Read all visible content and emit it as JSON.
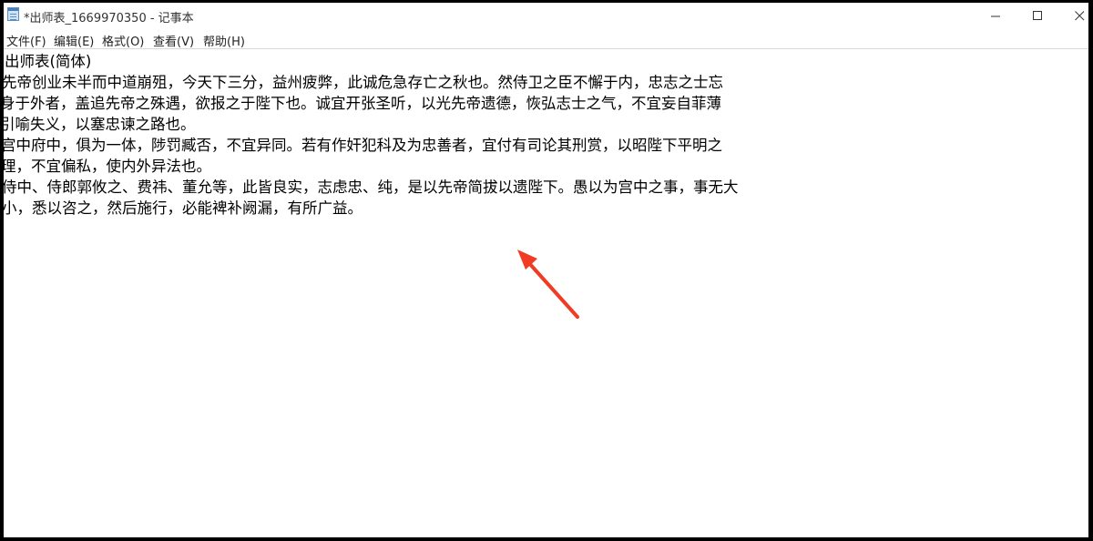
{
  "window": {
    "title": "*出师表_1669970350 - 记事本",
    "app_icon": "notepad-icon",
    "controls": {
      "minimize_icon": "minimize-icon",
      "maximize_icon": "maximize-icon",
      "close_icon": "close-icon"
    }
  },
  "menu": {
    "items": [
      {
        "label": "文件(F)"
      },
      {
        "label": "编辑(E)"
      },
      {
        "label": "格式(O)"
      },
      {
        "label": "查看(V)"
      },
      {
        "label": "帮助(H)"
      }
    ]
  },
  "editor": {
    "lines": [
      "出师表(简体)",
      "先帝创业未半而中道崩殂，今天下三分，益州疲弊，此诚危急存亡之秋也。然侍卫之臣不懈于内，忠志之士忘",
      "身于外者，盖追先帝之殊遇，欲报之于陛下也。诚宜开张圣听，以光先帝遗德，恢弘志士之气，不宜妄自菲薄",
      "引喻失义，以塞忠谏之路也。",
      "宫中府中，俱为一体，陟罚臧否，不宜异同。若有作奸犯科及为忠善者，宜付有司论其刑赏，以昭陛下平明之",
      "理，不宜偏私，使内外异法也。",
      "侍中、侍郎郭攸之、费祎、董允等，此皆良实，志虑忠、纯，是以先帝简拔以遗陛下。愚以为宫中之事，事无大",
      "小，悉以咨之，然后施行，必能裨补阙漏，有所广益。"
    ]
  },
  "annotation": {
    "arrow_color": "#f03c24"
  }
}
